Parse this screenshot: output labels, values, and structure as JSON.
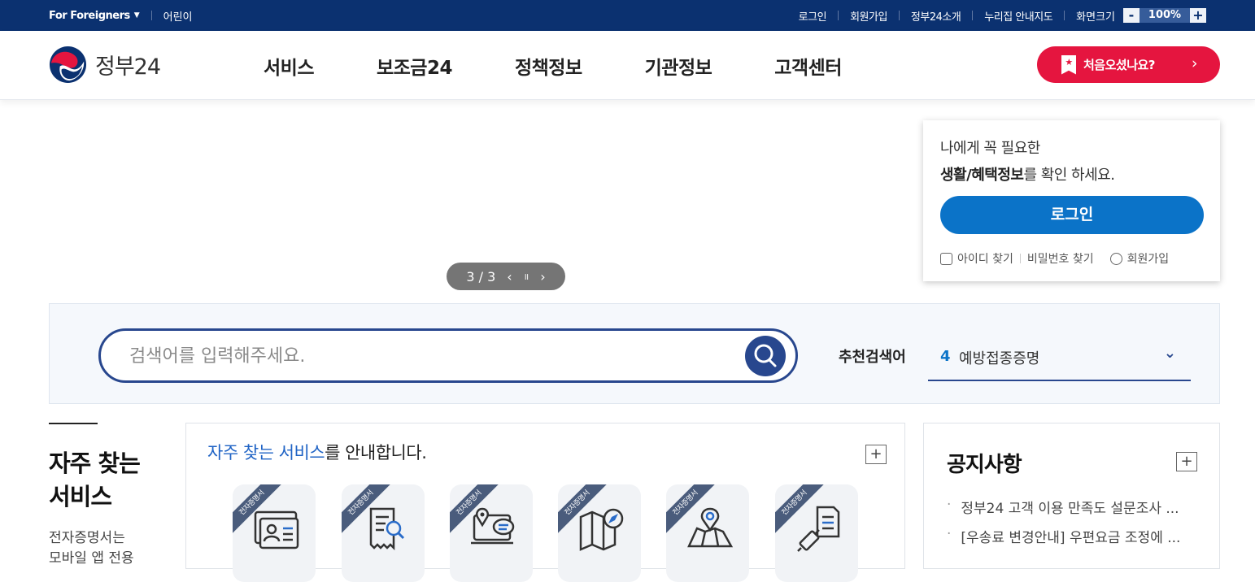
{
  "topbar": {
    "foreigners": "For Foreigners",
    "kids": "어린이",
    "links": [
      "로그인",
      "회원가입",
      "정부24소개",
      "누리집 안내지도",
      "화면크기"
    ],
    "zoom_minus": "-",
    "zoom_value": "100%",
    "zoom_plus": "+"
  },
  "header": {
    "logo_text": "정부24",
    "nav": [
      "서비스",
      "보조금24",
      "정책정보",
      "기관정보",
      "고객센터"
    ],
    "first_visit": "처음오셨나요?",
    "first_visit_arrow": "›"
  },
  "slider": {
    "counter": "3 / 3",
    "prev": "‹",
    "pause": "॥",
    "next": "›"
  },
  "login": {
    "line1": "나에게 꼭 필요한",
    "line2_bold": "생활/혜택정보",
    "line2_rest": "를 확인 하세요.",
    "button": "로그인",
    "find_id": "아이디 찾기",
    "find_pw": "비밀번호 찾기",
    "signup": "회원가입"
  },
  "search": {
    "placeholder": "검색어를 입력해주세요.",
    "recommend_label": "추천검색어",
    "recommend_num": "4",
    "recommend_text": "예방접종증명",
    "chevron": "⌄"
  },
  "frequent": {
    "side_title_line1": "자주 찾는",
    "side_title_line2": "서비스",
    "side_desc_line1": "전자증명서는",
    "side_desc_line2": "모바일 앱 전용",
    "panel_title_hl": "자주 찾는 서비스",
    "panel_title_rest": "를 안내합니다.",
    "plus": "+",
    "ribbon": "전자증명서",
    "icons": [
      "id-card-icon",
      "document-search-icon",
      "location-chat-icon",
      "map-compass-icon",
      "map-pin-icon",
      "vaccine-certificate-icon"
    ]
  },
  "notice": {
    "title": "공지사항",
    "plus": "+",
    "items": [
      "정부24 고객 이용 만족도 설문조사 ...",
      "[우송료 변경안내] 우편요금 조정에 ..."
    ]
  },
  "colors": {
    "topbar_bg": "#0b3170",
    "accent_blue": "#28478e",
    "login_blue": "#0b73c8",
    "cta_red": "#e5153f"
  }
}
